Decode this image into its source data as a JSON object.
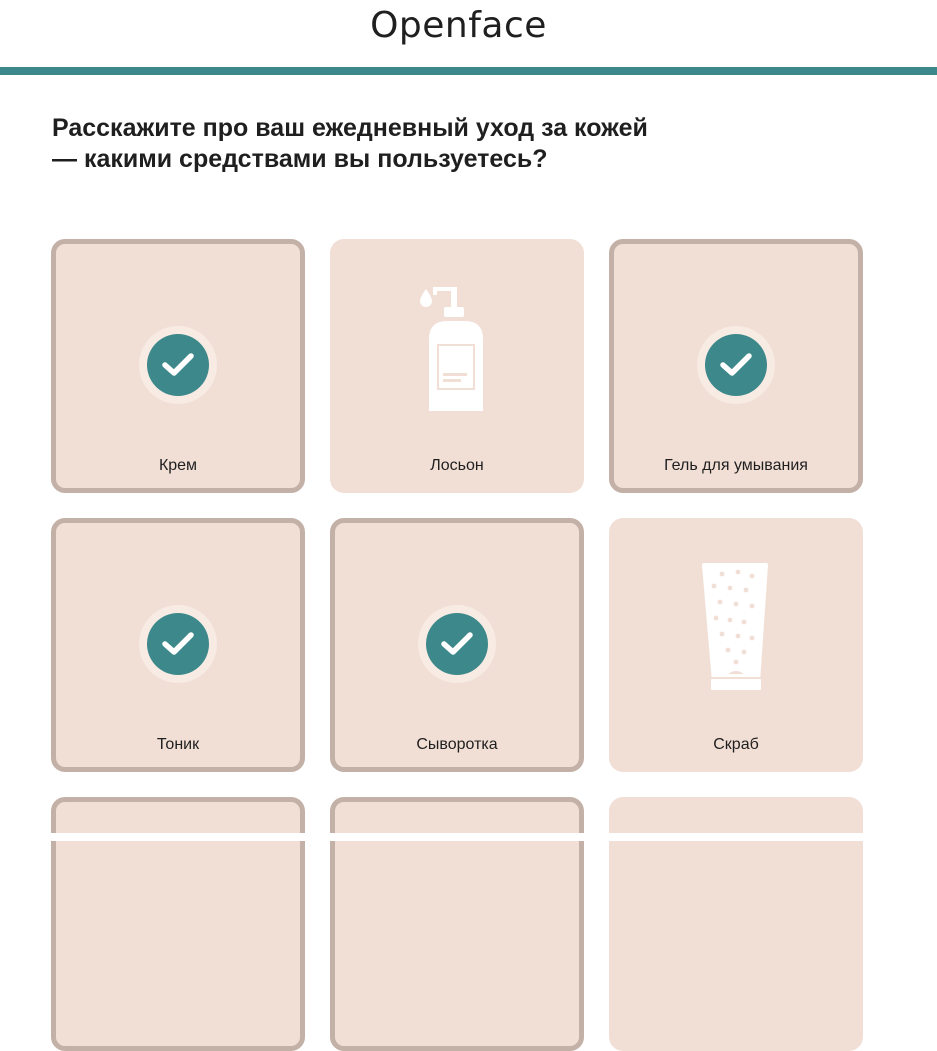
{
  "brand": {
    "logo_text": "Openface",
    "accent_color": "#3d888a",
    "card_color": "#f1dfd6",
    "selected_border_color": "#c3b1a7"
  },
  "question": {
    "text": "Расскажите про ваш ежедневный уход за кожей — какими средствами вы пользуетесь?"
  },
  "options": [
    {
      "label": "Крем",
      "selected": true,
      "icon": "check-icon"
    },
    {
      "label": "Лосьон",
      "selected": false,
      "icon": "lotion-pump-bottle-icon"
    },
    {
      "label": "Гель для умывания",
      "selected": true,
      "icon": "check-icon"
    },
    {
      "label": "Тоник",
      "selected": true,
      "icon": "check-icon"
    },
    {
      "label": "Сыворотка",
      "selected": true,
      "icon": "check-icon"
    },
    {
      "label": "Скраб",
      "selected": false,
      "icon": "scrub-tube-icon"
    },
    {
      "label": "",
      "selected": true
    },
    {
      "label": "",
      "selected": true
    },
    {
      "label": "",
      "selected": false
    }
  ]
}
